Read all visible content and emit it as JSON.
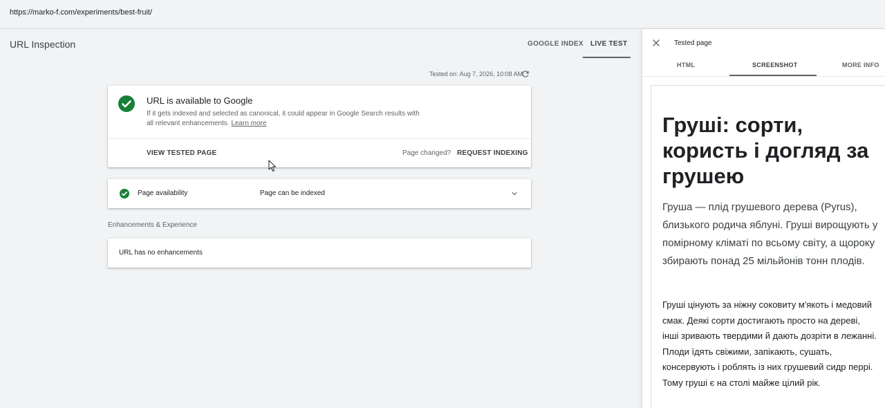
{
  "browser": {
    "url": "https://marko-f.com/experiments/best-fruit/"
  },
  "header": {
    "title": "URL Inspection",
    "tabs": [
      {
        "label": "GOOGLE INDEX",
        "active": false
      },
      {
        "label": "LIVE TEST",
        "active": true
      }
    ]
  },
  "test": {
    "tested_on": "Tested on: Aug 7, 2026, 10:08 AM"
  },
  "status_card": {
    "title": "URL is available to Google",
    "description": "If it gets indexed and selected as canonical, it could appear in Google Search results with all relevant enhancements.",
    "learn_more": "Learn more",
    "view_tested_page": "VIEW TESTED PAGE",
    "page_changed": "Page changed?",
    "request_indexing": "REQUEST INDEXING",
    "status_color": "#188038"
  },
  "availability": {
    "label": "Page availability",
    "value": "Page can be indexed"
  },
  "enhancements": {
    "section_label": "Enhancements & Experience",
    "text": "URL has no enhancements"
  },
  "panel": {
    "title": "Tested page",
    "tabs": [
      {
        "label": "HTML",
        "active": false
      },
      {
        "label": "SCREENSHOT",
        "active": true
      },
      {
        "label": "MORE INFO",
        "active": false
      }
    ],
    "screenshot": {
      "heading": "Груші: сорти, користь і догляд за грушею",
      "lead": "Груша — плід грушевого дерева (Pyrus), близького родича яблуні. Груші вирощують у помірному кліматі по всьому світу, а щороку збирають понад 25 мільйонів тонн плодів.",
      "body": "Груші цінують за ніжну соковиту м'якоть і медовий смак. Деякі сорти достигають просто на дереві, інші зривають твердими й дають дозріти в лежанні. Плоди їдять свіжими, запікають, сушать, консервують і роблять із них грушевий сидр перрі. Тому груші є на столі майже цілий рік."
    }
  },
  "icons": {
    "status": "check-circle-icon",
    "refresh": "refresh-icon",
    "expand": "chevron-down-icon",
    "close": "close-icon",
    "pointer": "mouse-pointer-icon"
  }
}
